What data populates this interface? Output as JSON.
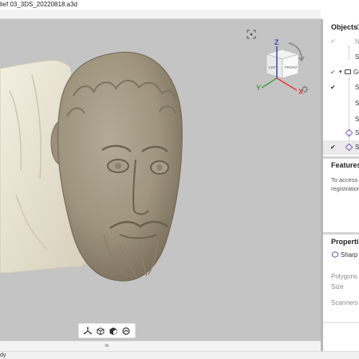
{
  "window": {
    "title": "lief 03_3DS_20220818.a3d"
  },
  "viewport": {
    "gizmo": {
      "z_label": "Z",
      "y_label": "Y",
      "x_label": "X",
      "cube_left_label": "LEFT",
      "cube_front_label": "FRONT"
    },
    "toolbar": {
      "items": [
        "axes-icon",
        "solid-cube-icon",
        "textured-cube-icon",
        "texture-mode-icon"
      ]
    },
    "expand_label": "≈"
  },
  "status": {
    "text": "dy"
  },
  "panel": {
    "objects": {
      "title": "Objects",
      "name_col": "N",
      "rows": [
        {
          "checked": false,
          "label": "S"
        },
        {
          "checked": true,
          "label": "Gr",
          "expanded": true
        },
        {
          "checked": true,
          "label": "S"
        },
        {
          "checked": false,
          "label": "S"
        },
        {
          "checked": false,
          "label": "S"
        },
        {
          "checked": false,
          "label": "Sh"
        },
        {
          "checked": true,
          "label": "Sh"
        }
      ]
    },
    "features": {
      "title": "Features",
      "line1": "To access t",
      "line2": "registration"
    },
    "properties": {
      "title": "Properties",
      "selected": "Sharp f",
      "polygons_label": "Polygons",
      "size_label": "Size",
      "scanners_label": "Scanners"
    }
  },
  "colors": {
    "viewport_bg": "#c4c4c4",
    "model_main": "#a49a86",
    "model_light": "#ece7d6",
    "axis_x": "#e53935",
    "axis_y": "#43a047",
    "axis_z": "#3949ab",
    "accent": "#7b61c9"
  }
}
